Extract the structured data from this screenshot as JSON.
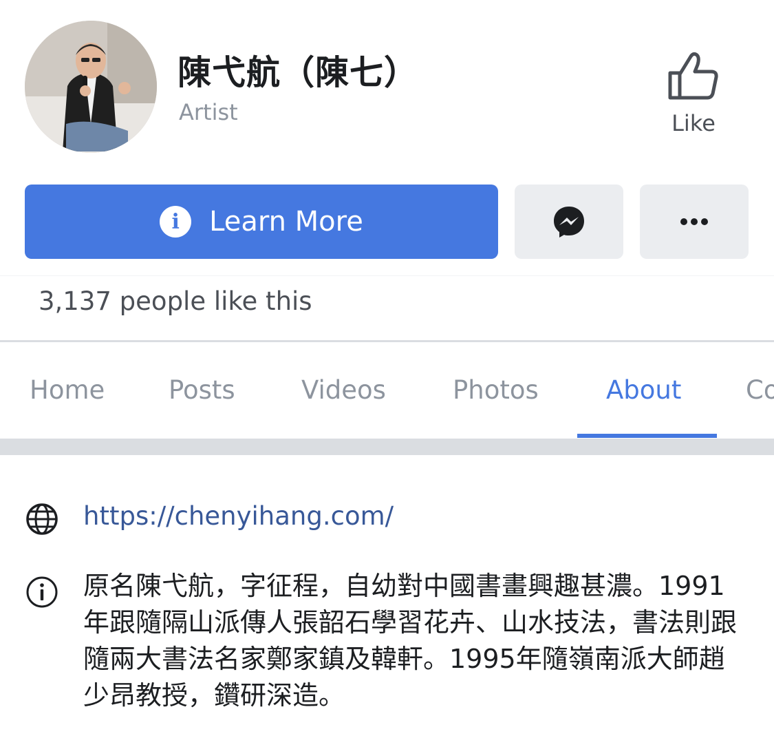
{
  "header": {
    "page_name": "陳弋航（陳七）",
    "category": "Artist",
    "like_label": "Like"
  },
  "actions": {
    "learn_more_label": "Learn More",
    "messenger_icon": "messenger-icon",
    "more_icon": "more-icon",
    "primary_color": "#4578e0"
  },
  "likes_count_text": "3,137 people like this",
  "tabs": [
    {
      "label": "Home",
      "active": false
    },
    {
      "label": "Posts",
      "active": false
    },
    {
      "label": "Videos",
      "active": false
    },
    {
      "label": "Photos",
      "active": false
    },
    {
      "label": "About",
      "active": true
    },
    {
      "label": "Co",
      "active": false
    }
  ],
  "about": {
    "website": "https://chenyihang.com/",
    "description": "原名陳弋航，字征程，自幼對中國書畫興趣甚濃。1991年跟隨隔山派傳人張韶石學習花卉、山水技法，書法則跟隨兩大書法名家鄭家鎮及韓軒。1995年隨嶺南派大師趙少昂教授，鑽研深造。"
  }
}
